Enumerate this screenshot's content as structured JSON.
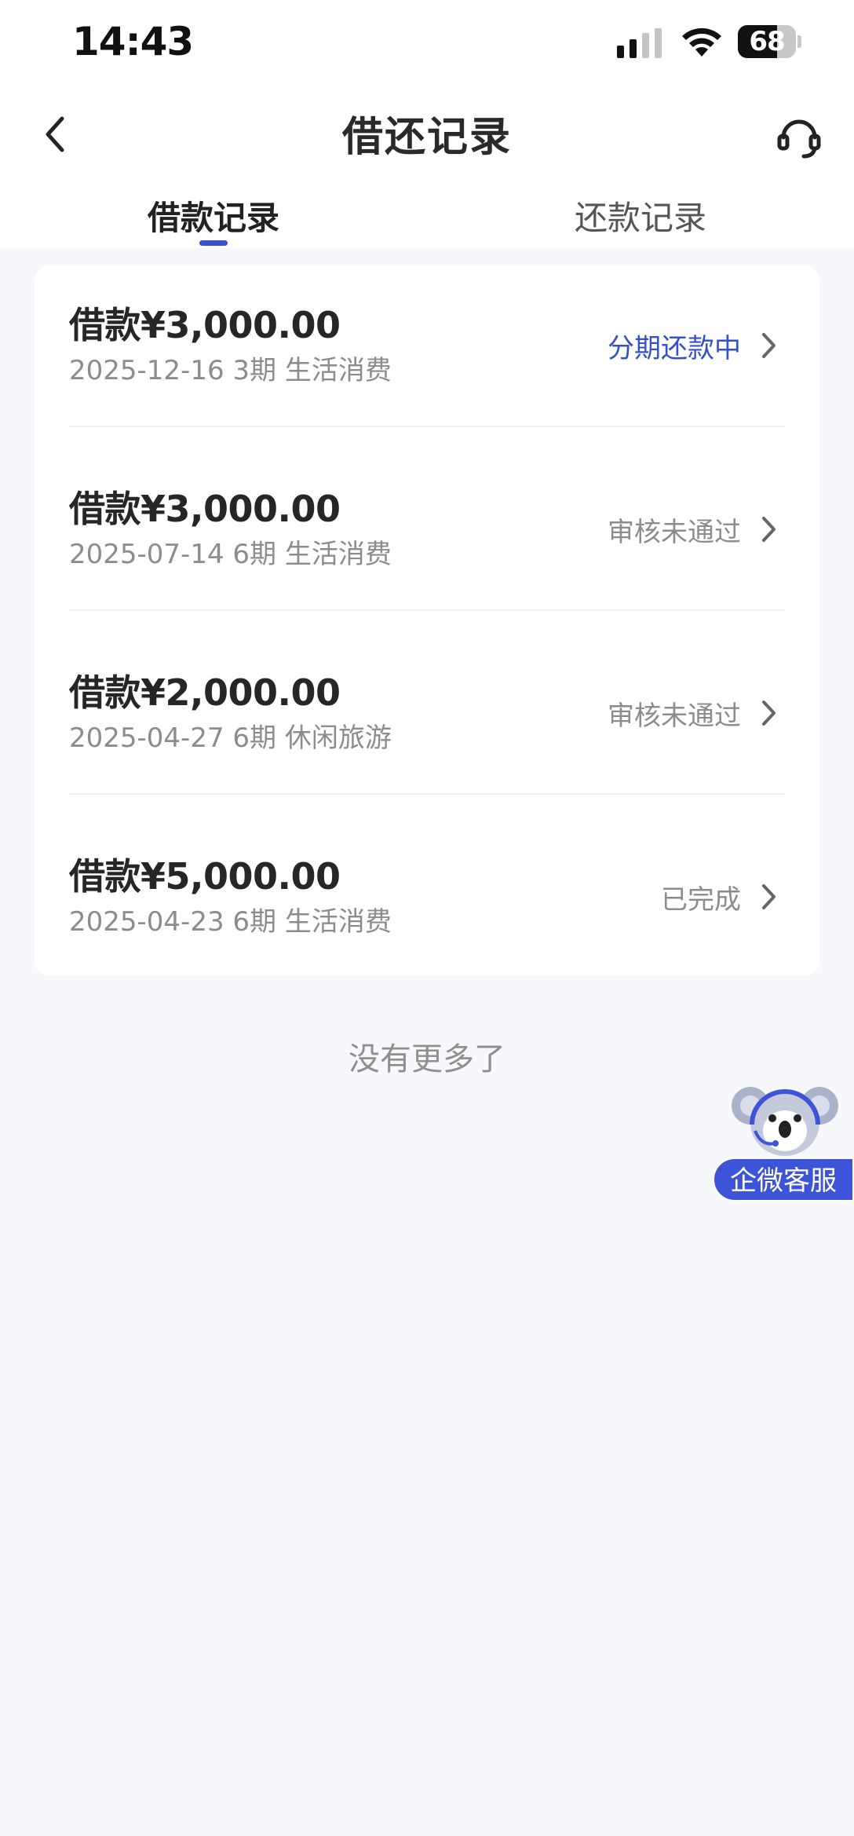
{
  "status_bar": {
    "time": "14:43",
    "battery": "68",
    "battery_level": 0.68
  },
  "header": {
    "title": "借还记录",
    "back_icon": "chevron-left-icon",
    "service_icon": "headset-icon"
  },
  "tabs": [
    {
      "label": "借款记录",
      "active": true
    },
    {
      "label": "还款记录",
      "active": false
    }
  ],
  "records": [
    {
      "amount": "借款¥3,000.00",
      "meta": "2025-12-16 3期  生活消费",
      "status": "分期还款中",
      "status_color": "#3550c8"
    },
    {
      "amount": "借款¥3,000.00",
      "meta": "2025-07-14 6期  生活消费",
      "status": "审核未通过",
      "status_color": "#8c8c8c"
    },
    {
      "amount": "借款¥2,000.00",
      "meta": "2025-04-27 6期  休闲旅游",
      "status": "审核未通过",
      "status_color": "#8c8c8c"
    },
    {
      "amount": "借款¥5,000.00",
      "meta": "2025-04-23 6期  生活消费",
      "status": "已完成",
      "status_color": "#8c8c8c"
    }
  ],
  "footer": {
    "no_more": "没有更多了"
  },
  "float_service": {
    "label": "企微客服",
    "icon": "koala-agent-icon"
  },
  "colors": {
    "accent": "#3c4fd1",
    "background": "#f7f8fc"
  }
}
